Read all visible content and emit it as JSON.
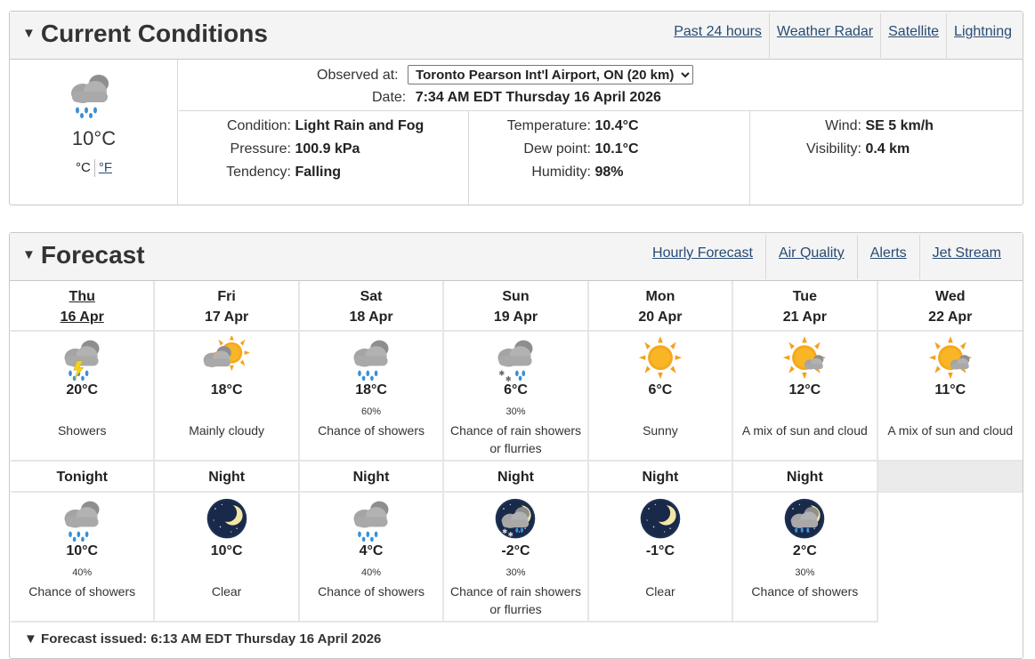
{
  "current": {
    "title": "Current Conditions",
    "links": [
      "Past 24 hours",
      "Weather Radar",
      "Satellite",
      "Lightning"
    ],
    "icon": "cloud-rain-icon",
    "temp": "10°C",
    "unit_c": "°C",
    "unit_f": "°F",
    "observed_label": "Observed at:",
    "station": "Toronto Pearson Int'l Airport, ON (20 km)",
    "date_label": "Date:",
    "date": "7:34 AM EDT Thursday 16 April 2026",
    "condition_label": "Condition:",
    "condition": "Light Rain and Fog",
    "pressure_label": "Pressure:",
    "pressure": "100.9 kPa",
    "tendency_label": "Tendency:",
    "tendency": "Falling",
    "temperature_label": "Temperature:",
    "temperature": "10.4°C",
    "dewpoint_label": "Dew point:",
    "dewpoint": "10.1°C",
    "humidity_label": "Humidity:",
    "humidity": "98%",
    "wind_label": "Wind:",
    "wind": "SE 5 km/h",
    "visibility_label": "Visibility:",
    "visibility": "0.4 km"
  },
  "forecast": {
    "title": "Forecast",
    "links": [
      "Hourly Forecast",
      "Air Quality",
      "Alerts",
      "Jet Stream"
    ],
    "days": [
      {
        "name": "Thu",
        "date": "16 Apr",
        "icon": "thunder-rain-icon",
        "temp": "20°C",
        "pop": "",
        "summary": "Showers"
      },
      {
        "name": "Fri",
        "date": "17 Apr",
        "icon": "sun-cloud-icon",
        "temp": "18°C",
        "pop": "",
        "summary": "Mainly cloudy"
      },
      {
        "name": "Sat",
        "date": "18 Apr",
        "icon": "cloud-rain-icon",
        "temp": "18°C",
        "pop": "60%",
        "summary": "Chance of showers"
      },
      {
        "name": "Sun",
        "date": "19 Apr",
        "icon": "rain-snow-icon",
        "temp": "6°C",
        "pop": "30%",
        "summary": "Chance of rain showers or flurries"
      },
      {
        "name": "Mon",
        "date": "20 Apr",
        "icon": "sun-icon",
        "temp": "6°C",
        "pop": "",
        "summary": "Sunny"
      },
      {
        "name": "Tue",
        "date": "21 Apr",
        "icon": "sun-small-cloud-icon",
        "temp": "12°C",
        "pop": "",
        "summary": "A mix of sun and cloud"
      },
      {
        "name": "Wed",
        "date": "22 Apr",
        "icon": "sun-small-cloud-icon",
        "temp": "11°C",
        "pop": "",
        "summary": "A mix of sun and cloud"
      }
    ],
    "nights": [
      {
        "name": "Tonight",
        "icon": "cloud-rain-icon",
        "temp": "10°C",
        "pop": "40%",
        "summary": "Chance of showers"
      },
      {
        "name": "Night",
        "icon": "moon-icon",
        "temp": "10°C",
        "pop": "",
        "summary": "Clear"
      },
      {
        "name": "Night",
        "icon": "cloud-rain-icon",
        "temp": "4°C",
        "pop": "40%",
        "summary": "Chance of showers"
      },
      {
        "name": "Night",
        "icon": "night-rain-snow-icon",
        "temp": "-2°C",
        "pop": "30%",
        "summary": "Chance of rain showers or flurries"
      },
      {
        "name": "Night",
        "icon": "moon-icon",
        "temp": "-1°C",
        "pop": "",
        "summary": "Clear"
      },
      {
        "name": "Night",
        "icon": "night-rain-icon",
        "temp": "2°C",
        "pop": "30%",
        "summary": "Chance of showers"
      }
    ],
    "issued": "Forecast issued: 6:13 AM EDT Thursday 16 April 2026"
  }
}
